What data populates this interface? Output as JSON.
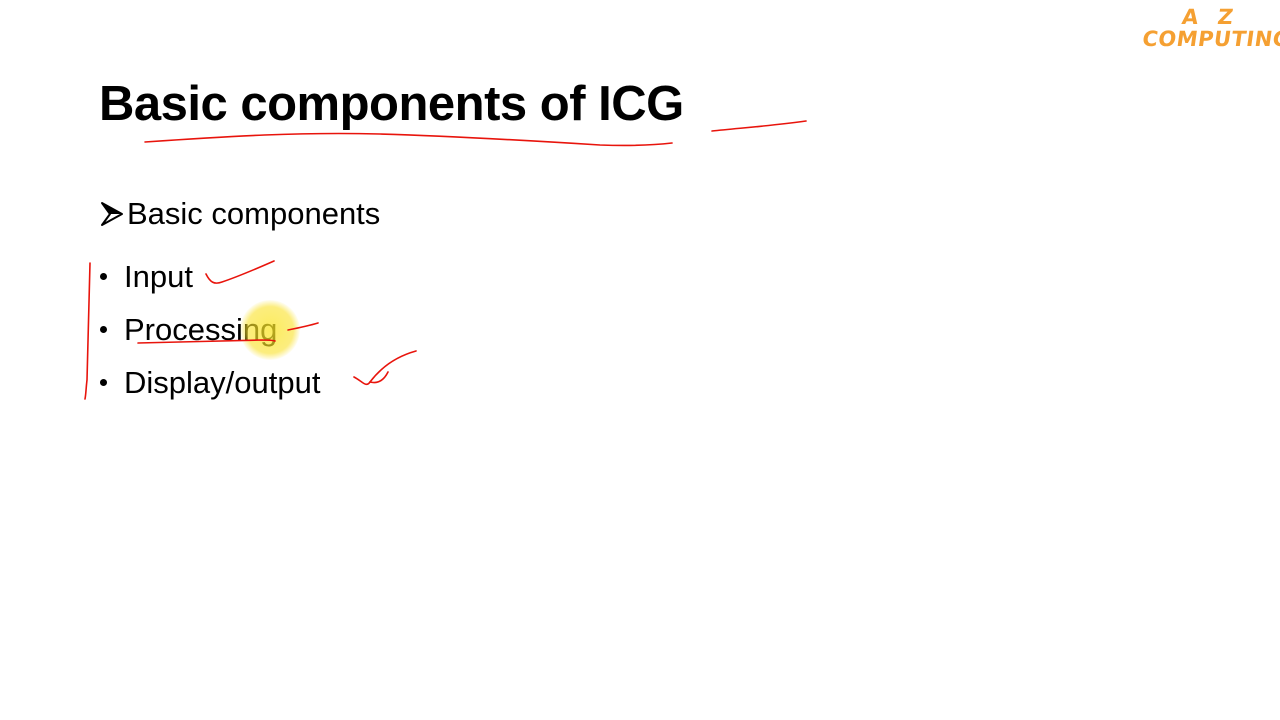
{
  "logo": {
    "line1": "A Z",
    "line2": "COMPUTING"
  },
  "slide": {
    "title": "Basic components of ICG",
    "subheading": "Basic components",
    "bullets": [
      {
        "label": "Input"
      },
      {
        "label": "Processing"
      },
      {
        "label": "Display/output"
      }
    ]
  },
  "colors": {
    "ink": "#e8140c",
    "logo": "#f5a032",
    "pointer": "#fae628"
  },
  "icons": {
    "subheading_marker": "right-arrowhead-icon",
    "bullet_marker": "bullet-dot-icon",
    "pointer": "laser-pointer-highlight"
  }
}
